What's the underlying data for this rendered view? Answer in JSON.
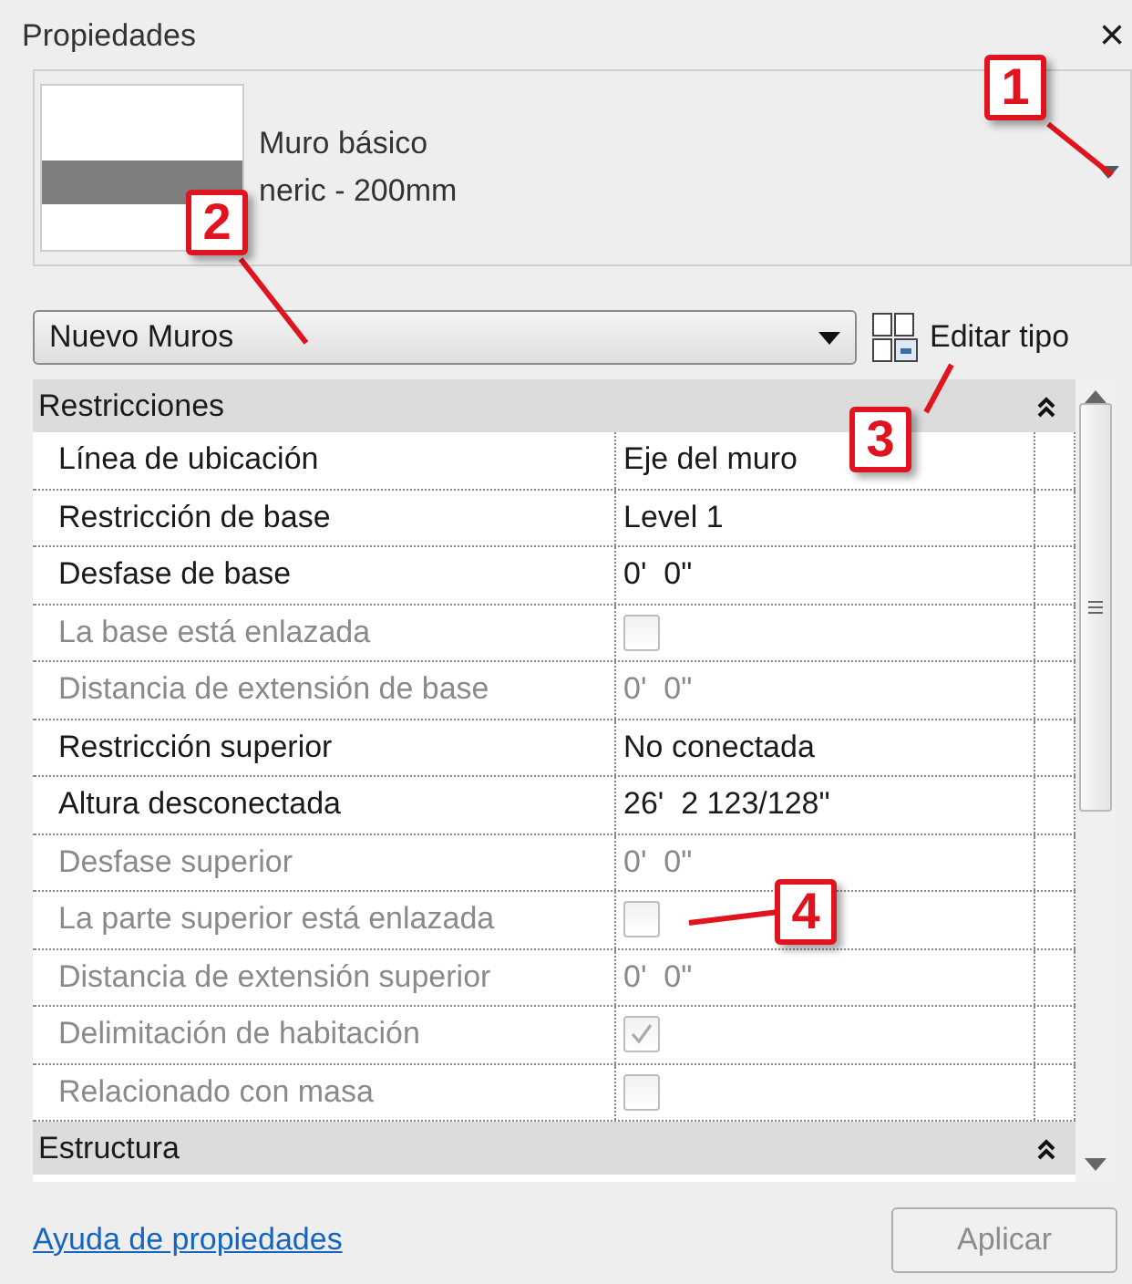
{
  "panel": {
    "title": "Propiedades",
    "close": "×"
  },
  "preview": {
    "family": "Muro básico",
    "type": "neric - 200mm"
  },
  "type_selector": {
    "value": "Nuevo Muros"
  },
  "edit_type": {
    "label": "Editar tipo"
  },
  "sections": [
    {
      "title": "Restricciones",
      "expanded": true,
      "rows": [
        {
          "label": "Línea de ubicación",
          "kind": "text",
          "value": "Eje del muro",
          "disabled": false
        },
        {
          "label": "Restricción de base",
          "kind": "text",
          "value": "Level 1",
          "disabled": false
        },
        {
          "label": "Desfase de base",
          "kind": "text",
          "value": "0'  0\"",
          "disabled": false
        },
        {
          "label": "La base está enlazada",
          "kind": "checkbox",
          "checked": false,
          "disabled": true
        },
        {
          "label": "Distancia de extensión de base",
          "kind": "text",
          "value": "0'  0\"",
          "disabled": true
        },
        {
          "label": "Restricción superior",
          "kind": "text",
          "value": "No conectada",
          "disabled": false
        },
        {
          "label": "Altura desconectada",
          "kind": "text",
          "value": "26'  2 123/128\"",
          "disabled": false
        },
        {
          "label": "Desfase superior",
          "kind": "text",
          "value": "0'  0\"",
          "disabled": true
        },
        {
          "label": "La parte superior está enlazada",
          "kind": "checkbox",
          "checked": false,
          "disabled": true
        },
        {
          "label": "Distancia de extensión superior",
          "kind": "text",
          "value": "0'  0\"",
          "disabled": true
        },
        {
          "label": "Delimitación de habitación",
          "kind": "checkbox",
          "checked": true,
          "disabled": true
        },
        {
          "label": "Relacionado con masa",
          "kind": "checkbox",
          "checked": false,
          "disabled": true
        }
      ]
    },
    {
      "title": "Estructura",
      "expanded": true
    }
  ],
  "help_link": "Ayuda de propiedades",
  "apply_button": {
    "label": "Aplicar",
    "disabled": true
  },
  "callouts": [
    {
      "label": "1"
    },
    {
      "label": "2"
    },
    {
      "label": "3"
    },
    {
      "label": "4"
    }
  ]
}
